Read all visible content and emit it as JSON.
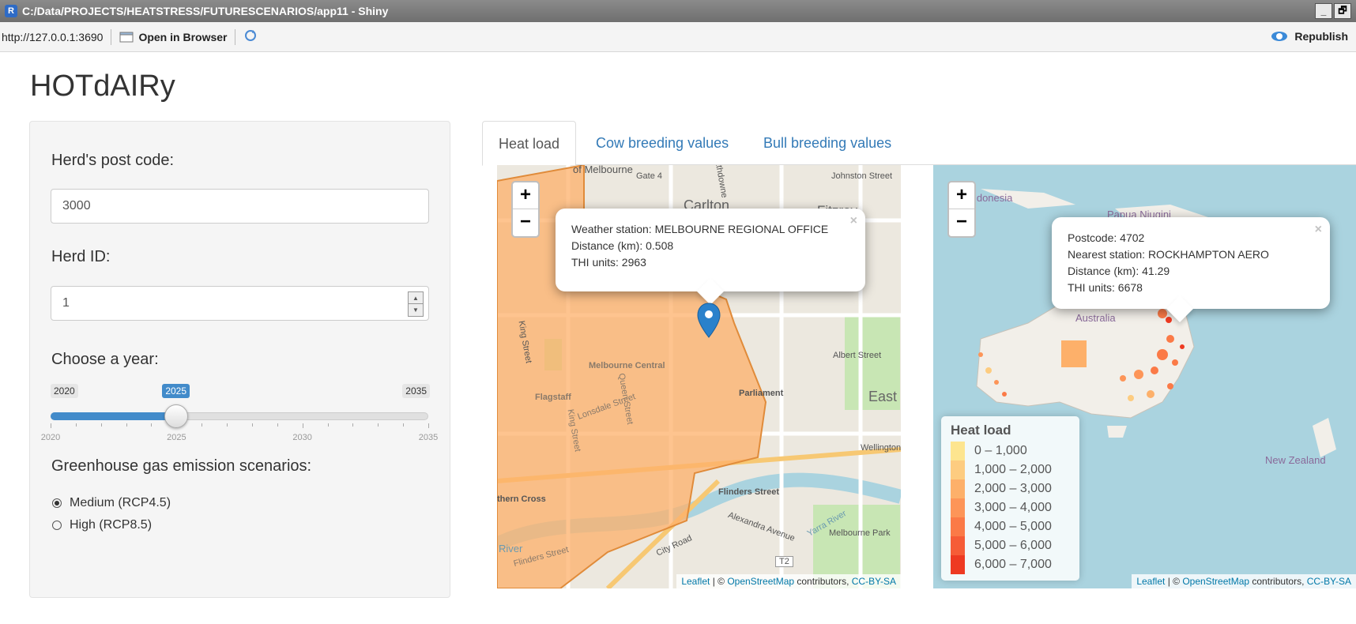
{
  "window": {
    "title": "C:/Data/PROJECTS/HEATSTRESS/FUTURESCENARIOS/app11 - Shiny",
    "minimize": "_",
    "maximize": "🗗"
  },
  "toolbar": {
    "url": "http://127.0.0.1:3690",
    "open_in_browser": "Open in Browser",
    "republish": "Republish"
  },
  "app": {
    "title": "HOTdAIRy"
  },
  "sidebar": {
    "postcode_label": "Herd's post code:",
    "postcode_value": "3000",
    "herd_id_label": "Herd ID:",
    "herd_id_value": "1",
    "year_label": "Choose a year:",
    "year_slider": {
      "min": 2020,
      "max": 2035,
      "value": 2025,
      "min_label": "2020",
      "max_label": "2035",
      "value_label": "2025",
      "ticks": [
        "2020",
        "2025",
        "2030",
        "2035"
      ]
    },
    "scenario_label": "Greenhouse gas emission scenarios:",
    "scenarios": [
      {
        "label": "Medium (RCP4.5)",
        "selected": true
      },
      {
        "label": "High (RCP8.5)",
        "selected": false
      }
    ]
  },
  "tabs": [
    {
      "label": "Heat load",
      "active": true
    },
    {
      "label": "Cow breeding values",
      "active": false
    },
    {
      "label": "Bull breeding values",
      "active": false
    }
  ],
  "map_left": {
    "zoom_in": "+",
    "zoom_out": "−",
    "popup": {
      "line1": "Weather station: MELBOURNE REGIONAL OFFICE",
      "line2": "Distance (km): 0.508",
      "line3": "THI units: 2963",
      "close": "×"
    },
    "labels": {
      "carlton": "Carlton",
      "fitzroy": "Fitzroy",
      "east": "East",
      "parliament": "Parliament",
      "melbourne_central": "Melbourne Central",
      "flagstaff": "Flagstaff",
      "southern_cross": "thern Cross",
      "melbourne_park": "Melbourne Park",
      "johnston_street": "Johnston Street",
      "albert_street": "Albert Street",
      "wellington": "Wellington",
      "flinders_street": "Flinders Street",
      "alexandra_avenue": "Alexandra Avenue",
      "city_road": "City Road",
      "yarra_river": "Yarra River",
      "gate4": "Gate 4",
      "king_street": "King Street",
      "t2": "T2",
      "river": "River",
      "lonsdale": "Lonsdale Street",
      "queen_street": "Queen Street",
      "of_melbourne": "of Melbourne",
      "rathdowne": "Rathdowne",
      "flinders_st2": "Flinders Street"
    },
    "attribution": {
      "leaflet": "Leaflet",
      "sep": " | © ",
      "osm": "OpenStreetMap",
      "contributors": " contributors, ",
      "license": "CC-BY-SA"
    }
  },
  "map_right": {
    "zoom_in": "+",
    "zoom_out": "−",
    "popup": {
      "line1": "Postcode: 4702",
      "line2": "Nearest station: ROCKHAMPTON AERO",
      "line3": "Distance (km): 41.29",
      "line4": "THI units: 6678",
      "close": "×"
    },
    "labels": {
      "indonesia": "Indonesia",
      "papua": "Papua Niugini",
      "australia": "Australia",
      "new_zealand": "New Zealand"
    },
    "legend": {
      "title": "Heat load",
      "items": [
        {
          "label": "0 – 1,000",
          "color": "#fde58f"
        },
        {
          "label": "1,000 – 2,000",
          "color": "#fdcc80"
        },
        {
          "label": "2,000 – 3,000",
          "color": "#fdb06a"
        },
        {
          "label": "3,000 – 4,000",
          "color": "#fd9558"
        },
        {
          "label": "4,000 – 5,000",
          "color": "#fb7a47"
        },
        {
          "label": "5,000 – 6,000",
          "color": "#f65c37"
        },
        {
          "label": "6,000 – 7,000",
          "color": "#ee3a22"
        }
      ]
    },
    "attribution": {
      "leaflet": "Leaflet",
      "sep": " | © ",
      "osm": "OpenStreetMap",
      "contributors": " contributors, ",
      "license": "CC-BY-SA"
    }
  },
  "colors": {
    "accent": "#428bca",
    "link": "#337ab7",
    "heat_fill": "#fdb06a",
    "marker": "#2a81cb"
  }
}
